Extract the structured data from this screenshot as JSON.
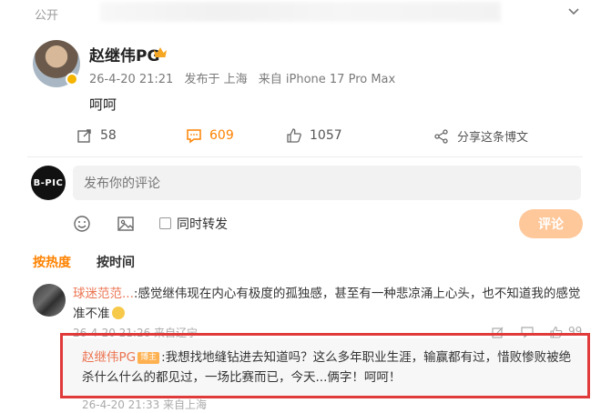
{
  "header": {
    "visibility": "公开"
  },
  "post": {
    "author": "赵继伟PG",
    "time": "26-4-20 21:21",
    "location": "发布于 上海",
    "device": "来自 iPhone 17 Pro Max",
    "text": "呵呵"
  },
  "actions": {
    "repost_count": "58",
    "comment_count": "609",
    "like_count": "1057",
    "share_label": "分享这条博文"
  },
  "composer": {
    "avatar_text": "B-PIC",
    "placeholder": "发布你的评论",
    "repost_label": "同时转发",
    "submit_label": "评论"
  },
  "sort_tabs": [
    {
      "label": "按热度",
      "active": true
    },
    {
      "label": "按时间",
      "active": false
    }
  ],
  "comment": {
    "user": "球迷范范...",
    "text": ":感觉继伟现在内心有极度的孤独感，甚至有一种悲凉涌上心头，也不知道我的感觉准不准",
    "meta": "26-4-20 21:26 来自辽宁",
    "like_count": "99"
  },
  "reply": {
    "user": "赵继伟PG",
    "author_tag": "博主",
    "text": ":我想找地缝钻进去知道吗？这么多年职业生涯，输赢都有过，惜败惨败被绝杀什么什么的都见过，一场比赛而已，今天...俩字！呵呵！",
    "meta": "26-4-20 21:33 来自上海"
  },
  "colors": {
    "accent": "#ff8200",
    "username": "#eb7350",
    "highlight_frame": "#e03a3a"
  }
}
